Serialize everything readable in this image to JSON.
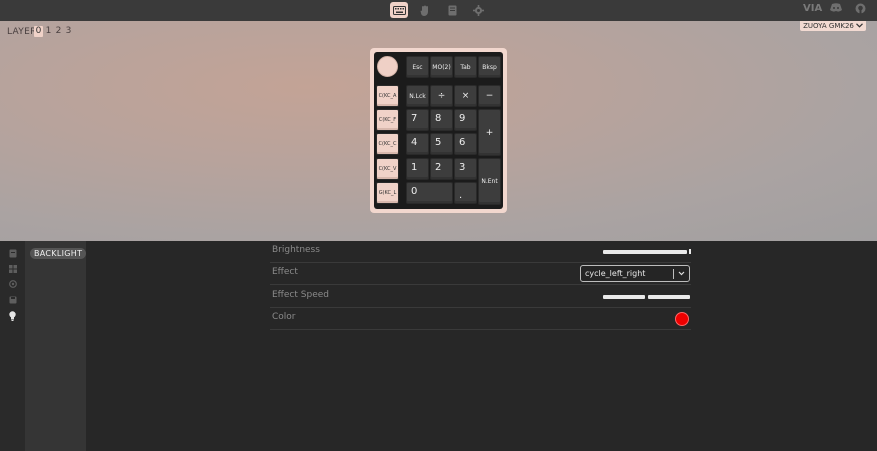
{
  "topbar": {
    "nav": [
      {
        "name": "keyboard",
        "icon": "keyboard-icon",
        "active": true
      },
      {
        "name": "test",
        "icon": "hand-icon",
        "active": false
      },
      {
        "name": "design",
        "icon": "book-icon",
        "active": false
      },
      {
        "name": "settings",
        "icon": "gear-icon",
        "active": false
      }
    ],
    "brand": "VIA",
    "right_icons": [
      "discord-icon",
      "github-icon"
    ]
  },
  "canvas": {
    "layer_label": "LAYER",
    "layers": [
      "0",
      "1",
      "2",
      "3"
    ],
    "active_layer": "0",
    "keyboard_name": "ZUOYA GMK26",
    "keyboard_chevron": "chevron-down-icon"
  },
  "keymap": {
    "left_column": [
      "C(KC_A)",
      "C(KC_F)",
      "C(KC_C)",
      "C(KC_V)",
      "G(KC_L)"
    ],
    "left_column_display": [
      "C(KC_A",
      "C(KC_F",
      "C(KC_C",
      "C(KC_V",
      "G(KC_L"
    ],
    "row0": [
      "Esc",
      "MO(2)",
      "Tab",
      "Bksp"
    ],
    "row1": [
      "N.Lck",
      "÷",
      "×",
      "−"
    ],
    "row2": [
      "7",
      "8",
      "9"
    ],
    "row3": [
      "4",
      "5",
      "6"
    ],
    "row4": [
      "1",
      "2",
      "3"
    ],
    "row5": [
      "0",
      "."
    ],
    "plus": "+",
    "enter": "N.Ent"
  },
  "sidebar": {
    "icons": [
      "keyboard-icon",
      "grid-icon",
      "circle-icon",
      "save-icon",
      "bulb-icon"
    ],
    "active_icon": "bulb-icon",
    "menu_item": "BACKLIGHT"
  },
  "settings": {
    "brightness_label": "Brightness",
    "brightness_value": 0.98,
    "effect_label": "Effect",
    "effect_value": "cycle_left_right",
    "effect_speed_label": "Effect Speed",
    "effect_speed_value": 0.5,
    "color_label": "Color",
    "color_value": "#ee0000"
  }
}
